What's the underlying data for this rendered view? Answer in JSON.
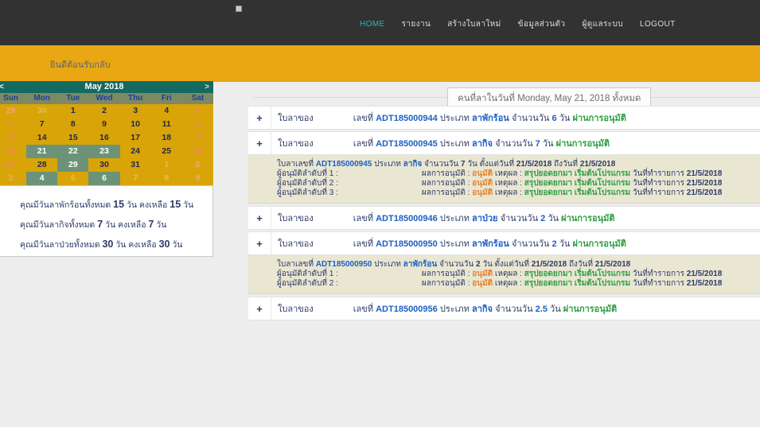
{
  "navbar": {
    "items": [
      {
        "id": "home",
        "label": "HOME",
        "active": true
      },
      {
        "id": "reports",
        "label": "รายงาน",
        "active": false
      },
      {
        "id": "create-leave",
        "label": "สร้างใบลาใหม่",
        "active": false
      },
      {
        "id": "personal-info",
        "label": "ข้อมูลส่วนตัว",
        "active": false
      },
      {
        "id": "admin",
        "label": "ผู้ดูแลระบบ",
        "active": false
      },
      {
        "id": "logout",
        "label": "LOGOUT",
        "active": false
      }
    ]
  },
  "banner": {
    "welcome": "ยินดีต้อนรับกลับ"
  },
  "calendar": {
    "title": "May 2018",
    "prev": "<",
    "next": ">",
    "day_headers": [
      "Sun",
      "Mon",
      "Tue",
      "Wed",
      "Thu",
      "Fri",
      "Sat"
    ],
    "weeks": [
      [
        [
          "29",
          "mw"
        ],
        [
          "30",
          "m"
        ],
        [
          "1",
          "n"
        ],
        [
          "2",
          "n"
        ],
        [
          "3",
          "n"
        ],
        [
          "4",
          "n"
        ],
        [
          "5",
          "w"
        ]
      ],
      [
        [
          "6",
          "w"
        ],
        [
          "7",
          "n"
        ],
        [
          "8",
          "n"
        ],
        [
          "9",
          "n"
        ],
        [
          "10",
          "n"
        ],
        [
          "11",
          "n"
        ],
        [
          "12",
          "w"
        ]
      ],
      [
        [
          "13",
          "w"
        ],
        [
          "14",
          "n"
        ],
        [
          "15",
          "n"
        ],
        [
          "16",
          "n"
        ],
        [
          "17",
          "n"
        ],
        [
          "18",
          "n"
        ],
        [
          "19",
          "w"
        ]
      ],
      [
        [
          "20",
          "w"
        ],
        [
          "21",
          "sel"
        ],
        [
          "22",
          "sel"
        ],
        [
          "23",
          "sel"
        ],
        [
          "24",
          "n"
        ],
        [
          "25",
          "n"
        ],
        [
          "26",
          "w"
        ]
      ],
      [
        [
          "27",
          "w"
        ],
        [
          "28",
          "n"
        ],
        [
          "29",
          "sel"
        ],
        [
          "30",
          "n"
        ],
        [
          "31",
          "n"
        ],
        [
          "1",
          "m"
        ],
        [
          "2",
          "mw"
        ]
      ],
      [
        [
          "3",
          "mw"
        ],
        [
          "4",
          "sel"
        ],
        [
          "5",
          "m"
        ],
        [
          "6",
          "sel"
        ],
        [
          "7",
          "m"
        ],
        [
          "8",
          "m"
        ],
        [
          "9",
          "mw"
        ]
      ]
    ],
    "highlight_color": "#6c9377",
    "weekend_color": "#ef8d55"
  },
  "summary": {
    "lines": [
      {
        "before": "คุณมีวันลาพักร้อนทั้งหมด",
        "total": "15",
        "mid": "วัน คงเหลือ",
        "remain": "15",
        "after": "วัน"
      },
      {
        "before": "คุณมีวันลากิจทั้งหมด",
        "total": "7",
        "mid": "วัน คงเหลือ",
        "remain": "7",
        "after": "วัน"
      },
      {
        "before": "คุณมีวันลาป่วยทั้งหมด",
        "total": "30",
        "mid": "วัน คงเหลือ",
        "remain": "30",
        "after": "วัน"
      }
    ]
  },
  "main": {
    "header": "คนที่ลาในวันที่ Monday, May 21, 2018 ทั้งหมด",
    "labels": {
      "of": "ใบลาของ",
      "no": "เลขที่",
      "type": "ประเภท",
      "days": "จำนวนวัน",
      "day_unit": "วัน",
      "doc_no": "ใบลาเลขที่",
      "from": "ตั้งแต่วันที่",
      "to": "ถึงวันที่",
      "approver": "ผู้อนุมัติลำดับที่",
      "result": "ผลการอนุมัติ",
      "reason": "เหตุผล",
      "txn_date": "วันที่ทำรายการ",
      "expand_icon": "+"
    },
    "rows": [
      {
        "number": "ADT185000944",
        "type": "ลาพักร้อน",
        "days": "6",
        "status": "ผ่านการอนุมัติ"
      },
      {
        "number": "ADT185000945",
        "type": "ลากิจ",
        "days": "7",
        "status": "ผ่านการอนุมัติ",
        "detail": {
          "from": "21/5/2018",
          "to": "21/5/2018",
          "approvers": [
            {
              "order": "1",
              "result": "อนุมัติ",
              "reason": "สรุปยอดยกมา เริ่มต้นโปรแกรม",
              "date": "21/5/2018"
            },
            {
              "order": "2",
              "result": "อนุมัติ",
              "reason": "สรุปยอดยกมา เริ่มต้นโปรแกรม",
              "date": "21/5/2018"
            },
            {
              "order": "3",
              "result": "อนุมัติ",
              "reason": "สรุปยอดยกมา เริ่มต้นโปรแกรม",
              "date": "21/5/2018"
            }
          ]
        }
      },
      {
        "number": "ADT185000946",
        "type": "ลาป่วย",
        "days": "2",
        "status": "ผ่านการอนุมัติ"
      },
      {
        "number": "ADT185000950",
        "type": "ลาพักร้อน",
        "days": "2",
        "status": "ผ่านการอนุมัติ",
        "detail": {
          "from": "21/5/2018",
          "to": "21/5/2018",
          "approvers": [
            {
              "order": "1",
              "result": "อนุมัติ",
              "reason": "สรุปยอดยกมา เริ่มต้นโปรแกรม",
              "date": "21/5/2018"
            },
            {
              "order": "2",
              "result": "อนุมัติ",
              "reason": "สรุปยอดยกมา เริ่มต้นโปรแกรม",
              "date": "21/5/2018"
            }
          ]
        }
      },
      {
        "number": "ADT185000956",
        "type": "ลากิจ",
        "days": "2.5",
        "status": "ผ่านการอนุมัติ"
      }
    ],
    "colors": {
      "accent_blue": "#1d5fc2",
      "approved_green": "#2f9e44",
      "result_orange": "#e8822d",
      "navy": "#2e3b68"
    }
  }
}
